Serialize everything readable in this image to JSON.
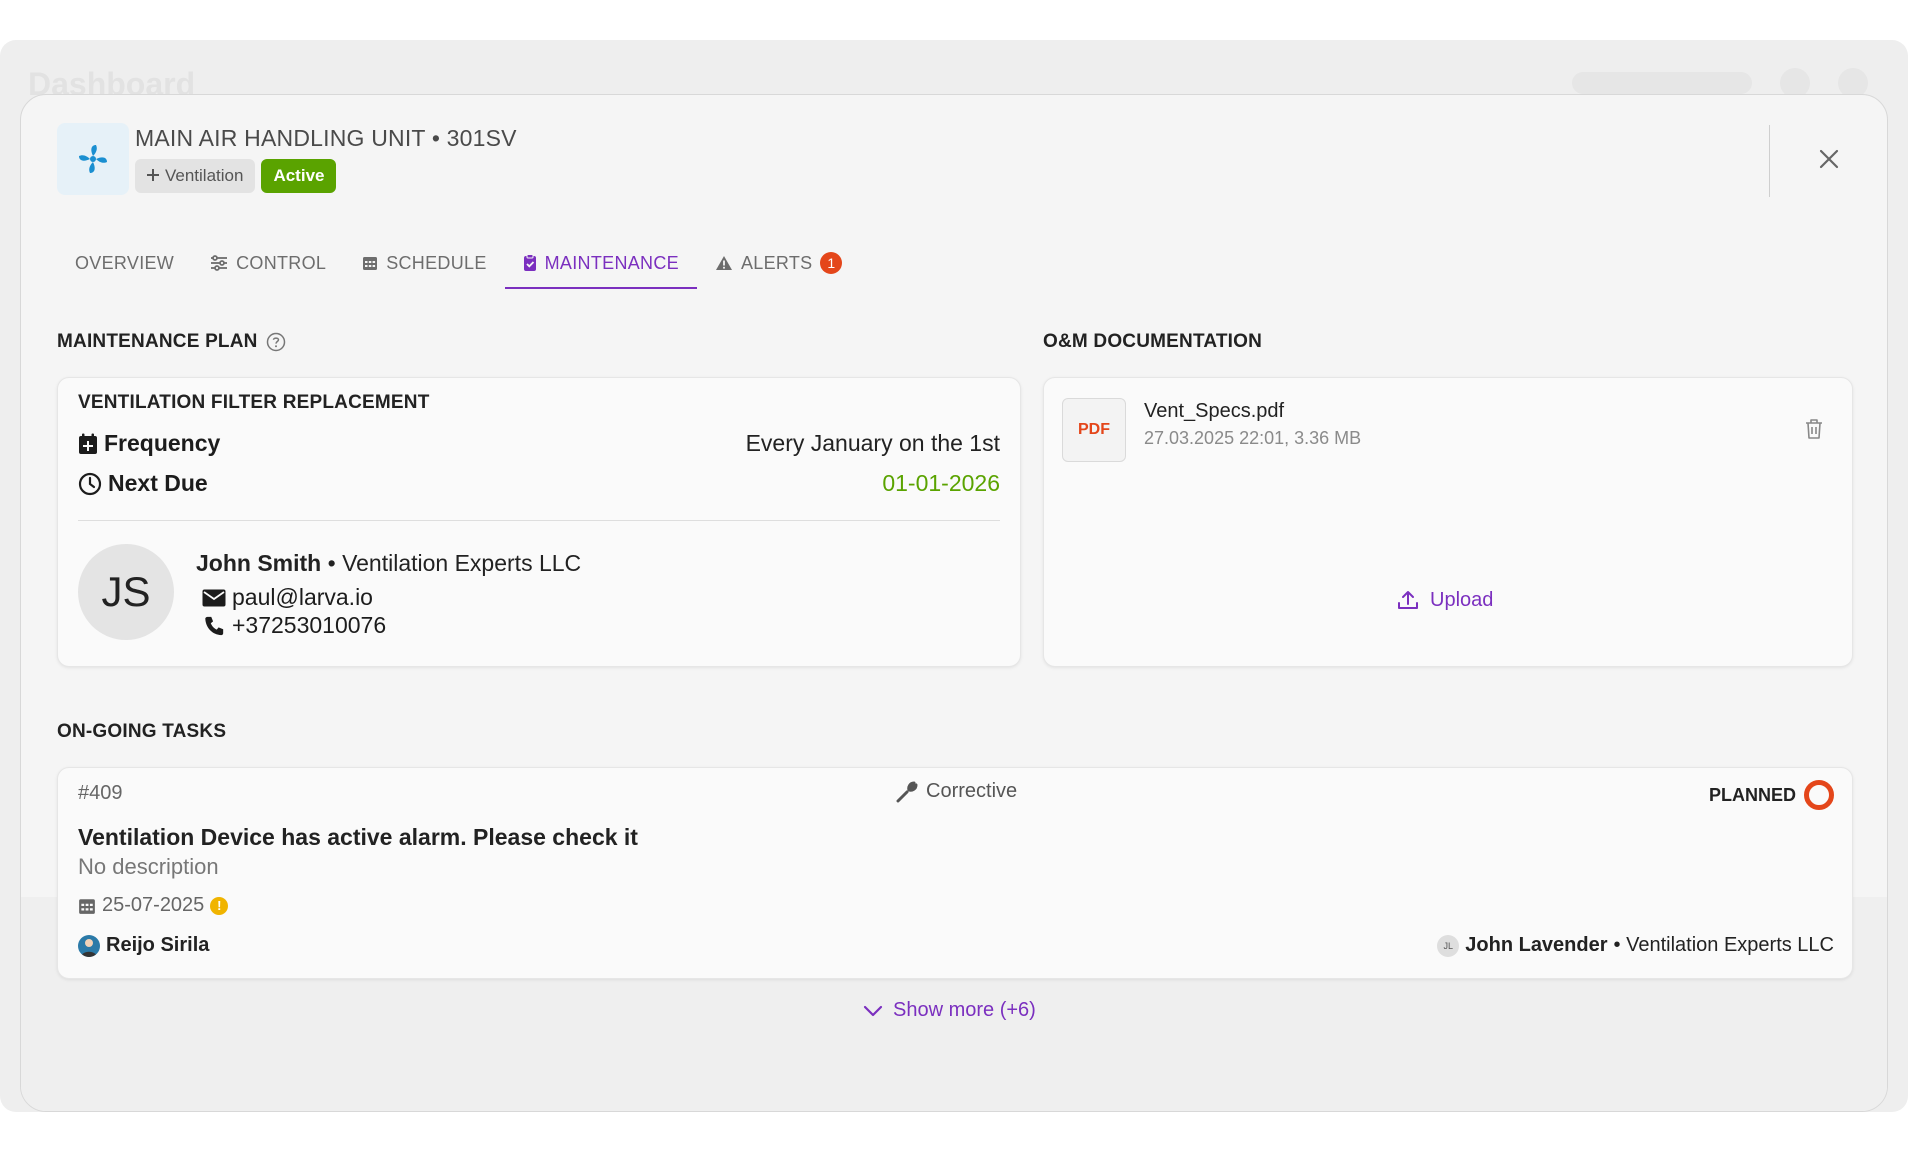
{
  "background": {
    "title": "Dashboard"
  },
  "header": {
    "title": "MAIN AIR HANDLING UNIT • 301SV",
    "category_tag": "Ventilation",
    "status_tag": "Active",
    "icon": "fan-icon"
  },
  "tabs": [
    {
      "label": "OVERVIEW",
      "icon": ""
    },
    {
      "label": "CONTROL",
      "icon": "sliders-icon"
    },
    {
      "label": "SCHEDULE",
      "icon": "calendar-icon"
    },
    {
      "label": "MAINTENANCE",
      "icon": "clipboard-icon",
      "active": true
    },
    {
      "label": "ALERTS",
      "icon": "warning-icon",
      "badge": "1"
    }
  ],
  "maintenance_plan": {
    "section_title": "MAINTENANCE PLAN",
    "name": "VENTILATION FILTER REPLACEMENT",
    "frequency_label": "Frequency",
    "frequency_value": "Every January on the 1st",
    "next_due_label": "Next Due",
    "next_due_value": "01-01-2026",
    "contact": {
      "initials": "JS",
      "name": "John Smith",
      "company": " • Ventilation Experts LLC",
      "email": "paul@larva.io",
      "phone": "+37253010076"
    }
  },
  "documentation": {
    "section_title": "O&M DOCUMENTATION",
    "file_type": "PDF",
    "file_name": "Vent_Specs.pdf",
    "file_meta": "27.03.2025 22:01, 3.36 MB",
    "upload_label": "Upload"
  },
  "tasks": {
    "section_title": "ON-GOING TASKS",
    "items": [
      {
        "id": "#409",
        "type": "Corrective",
        "status": "PLANNED",
        "title": "Ventilation Device has active alarm. Please check it",
        "description": "No description",
        "date": "25-07-2025",
        "assignee": "Reijo Sirila",
        "contractor_initials": "JL",
        "contractor_name": "John Lavender",
        "contractor_company": " • Ventilation Experts LLC"
      }
    ],
    "show_more_label": "Show more (+6)"
  },
  "colors": {
    "accent": "#7b2fbf",
    "active_green": "#5aa300",
    "alert_orange": "#e4461a",
    "brand_blue": "#1a8fd1"
  }
}
